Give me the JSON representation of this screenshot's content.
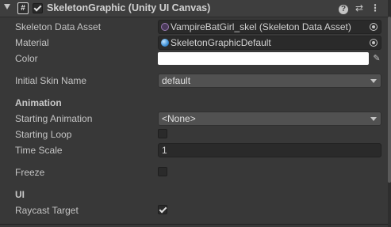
{
  "component": {
    "title": "SkeletonGraphic (Unity UI Canvas)",
    "enabled": true,
    "expanded": true,
    "header_icons": [
      "script-icon",
      "help-icon",
      "preset-icon",
      "more-icon"
    ]
  },
  "fields": {
    "skeleton_data_asset": {
      "label": "Skeleton Data Asset",
      "value": "VampireBatGirl_skel (Skeleton Data Asset)",
      "icon": "skeleton-data-icon"
    },
    "material": {
      "label": "Material",
      "value": "SkeletonGraphicDefault",
      "icon": "material-icon"
    },
    "color": {
      "label": "Color",
      "value": "#ffffff"
    },
    "initial_skin_name": {
      "label": "Initial Skin Name",
      "value": "default"
    }
  },
  "animation": {
    "section_label": "Animation",
    "starting_animation": {
      "label": "Starting Animation",
      "value": "<None>"
    },
    "starting_loop": {
      "label": "Starting Loop",
      "checked": false
    },
    "time_scale": {
      "label": "Time Scale",
      "value": "1"
    },
    "freeze": {
      "label": "Freeze",
      "checked": false
    }
  },
  "ui": {
    "section_label": "UI",
    "raycast_target": {
      "label": "Raycast Target",
      "checked": true
    }
  },
  "colors": {
    "background": "#383838",
    "header": "#3e3e3e",
    "field": "#2a2a2a",
    "dropdown": "#515151",
    "text": "#c4c4c4"
  }
}
